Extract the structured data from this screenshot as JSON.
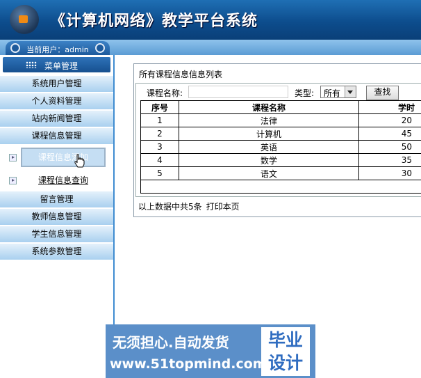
{
  "header": {
    "title": "《计算机网络》教学平台系统"
  },
  "user_bar": {
    "label": "当前用户：admin"
  },
  "sidebar": {
    "menu_header": "菜单管理",
    "items": [
      "系统用户管理",
      "个人资料管理",
      "站内新闻管理",
      "课程信息管理"
    ],
    "sub_items": [
      "课程信息添加",
      "课程信息查询"
    ],
    "items_after": [
      "留言管理",
      "教师信息管理",
      "学生信息管理",
      "系统参数管理"
    ]
  },
  "main": {
    "panel_title": "所有课程信息信息列表",
    "search": {
      "keyword_label": "课程名称:",
      "keyword_value": "",
      "type_label": "类型:",
      "type_value": "所有",
      "button_label": "查找"
    },
    "table": {
      "headers": [
        "序号",
        "课程名称",
        "学时"
      ],
      "rows": [
        [
          "1",
          "法律",
          "20"
        ],
        [
          "2",
          "计算机",
          "45"
        ],
        [
          "3",
          "英语",
          "50"
        ],
        [
          "4",
          "数学",
          "35"
        ],
        [
          "5",
          "语文",
          "30"
        ]
      ]
    },
    "footer": {
      "summary": "以上数据中共5条",
      "print_label": "打印本页"
    }
  },
  "watermark": {
    "line1": "无须担心.自动发货",
    "line2": "www.51topmind.com",
    "badge": "毕业设计"
  },
  "colors": {
    "header_blue": "#0d4d8d",
    "sidebar_light": "#a9d0ef",
    "watermark_blue": "#5b8fc9",
    "logo_orange": "#f08a14"
  }
}
